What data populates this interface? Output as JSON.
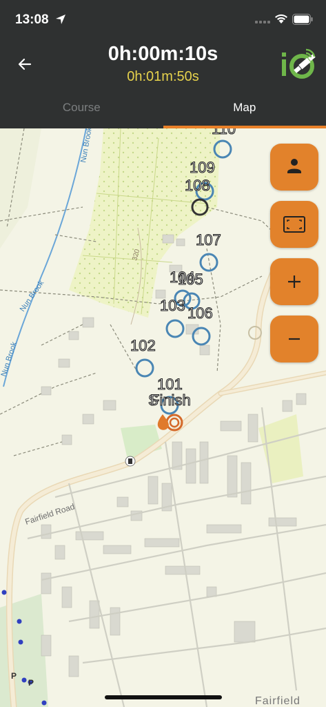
{
  "status_bar": {
    "time": "13:08",
    "icons": [
      "location-arrow-icon",
      "cellular-signal-icon",
      "wifi-icon",
      "battery-icon"
    ]
  },
  "header": {
    "back_icon": "arrow-left-icon",
    "elapsed_time": "0h:00m:10s",
    "remaining_time": "0h:01m:50s",
    "logo_icon": "io-satellite-logo"
  },
  "tabs": [
    {
      "label": "Course",
      "active": false
    },
    {
      "label": "Map",
      "active": true
    }
  ],
  "colors": {
    "header_bg": "#2f3131",
    "accent": "#e98028",
    "remaining_text": "#e6d24c",
    "control_marker": "#4a86b4",
    "finish_marker": "#d4692a"
  },
  "map": {
    "road_labels": [
      "Fairfield Road",
      "Nun Brook",
      "Nun Brook",
      "Nun Brook",
      "Fairfield"
    ],
    "contour_label": "320",
    "controls": [
      {
        "label": "110"
      },
      {
        "label": "109"
      },
      {
        "label": "108"
      },
      {
        "label": "107"
      },
      {
        "label": "104"
      },
      {
        "label": "105"
      },
      {
        "label": "103"
      },
      {
        "label": "106"
      },
      {
        "label": "102"
      },
      {
        "label": "101"
      }
    ],
    "start_label": "S",
    "finish_label": "Finish",
    "parking_labels": [
      "P",
      "P"
    ]
  },
  "map_controls": [
    {
      "name": "my-location",
      "icon": "person-icon"
    },
    {
      "name": "fit-course",
      "icon": "fit-bounds-icon"
    },
    {
      "name": "zoom-in",
      "icon": "plus-icon"
    },
    {
      "name": "zoom-out",
      "icon": "minus-icon"
    }
  ]
}
